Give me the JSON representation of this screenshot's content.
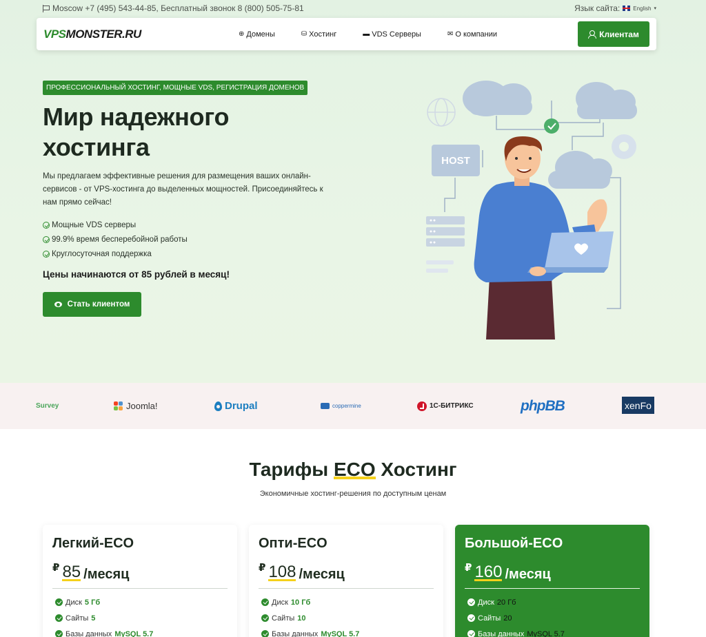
{
  "topbar": {
    "location_phone": "Moscow +7 (495) 543-44-85, Бесплатный звонок 8 (800) 505-75-81",
    "site_language_label": "Язык сайта:",
    "language": "English",
    "caret": "▾"
  },
  "navbar": {
    "logo_prefix": "VPS",
    "logo_suffix": "MONSTER.RU",
    "links": [
      {
        "icon": "⊕",
        "label": "Домены"
      },
      {
        "icon": "⛁",
        "label": "Хостинг"
      },
      {
        "icon": "▬",
        "label": "VDS Серверы"
      },
      {
        "icon": "✉",
        "label": "О компании"
      }
    ],
    "client_button": "Клиентам"
  },
  "hero": {
    "badge": "ПРОФЕССИОНАЛЬНЫЙ ХОСТИНГ, МОЩНЫЕ VDS, РЕГИСТРАЦИЯ ДОМЕНОВ",
    "title_line1": "Мир надежного",
    "title_line2": "хостинга",
    "description": "Мы предлагаем эффективные решения для размещения ваших онлайн-сервисов - от VPS-хостинга до выделенных мощностей. Присоединяйтесь к нам прямо сейчас!",
    "features": [
      "Мощные VDS серверы",
      "99.9% время бесперебойной работы",
      "Круглосуточная поддержка"
    ],
    "price_text": "Цены начинаются от 85 рублей в месяц!",
    "cta": "Стать клиентом",
    "illustration_label": "HOST"
  },
  "partners": {
    "survey": "Survey",
    "joomla": "Joomla!",
    "drupal": "Drupal",
    "coppermine": "coppermine",
    "bitrix": "1С-БИТРИКС",
    "phpbb": "phpBB",
    "xenforo": "xenFo"
  },
  "tariffs": {
    "title_pre": "Тарифы",
    "title_hl": "ECO",
    "title_post": "Хостинг",
    "subtitle": "Экономичные хостинг-решения по доступным ценам",
    "plans": [
      {
        "name": "Легкий-ECO",
        "currency": "₽",
        "price": "85",
        "per": "/месяц",
        "features": [
          {
            "label": "Диск",
            "value": "5 Гб"
          },
          {
            "label": "Сайты",
            "value": "5"
          },
          {
            "label": "Базы данных",
            "value": "MySQL 5.7"
          }
        ]
      },
      {
        "name": "Опти-ECO",
        "currency": "₽",
        "price": "108",
        "per": "/месяц",
        "features": [
          {
            "label": "Диск",
            "value": "10 Гб"
          },
          {
            "label": "Сайты",
            "value": "10"
          },
          {
            "label": "Базы данных",
            "value": "MySQL 5.7"
          }
        ]
      },
      {
        "name": "Большой-ECO",
        "currency": "₽",
        "price": "160",
        "per": "/месяц",
        "features": [
          {
            "label": "Диск",
            "value": "20 Гб"
          },
          {
            "label": "Сайты",
            "value": "20"
          },
          {
            "label": "Базы данных",
            "value": "MySQL 5.7"
          }
        ]
      }
    ]
  },
  "colors": {
    "brand_green": "#2d8b2d",
    "accent_yellow": "#f5d11b",
    "hero_bg": "#e3f2e3"
  }
}
